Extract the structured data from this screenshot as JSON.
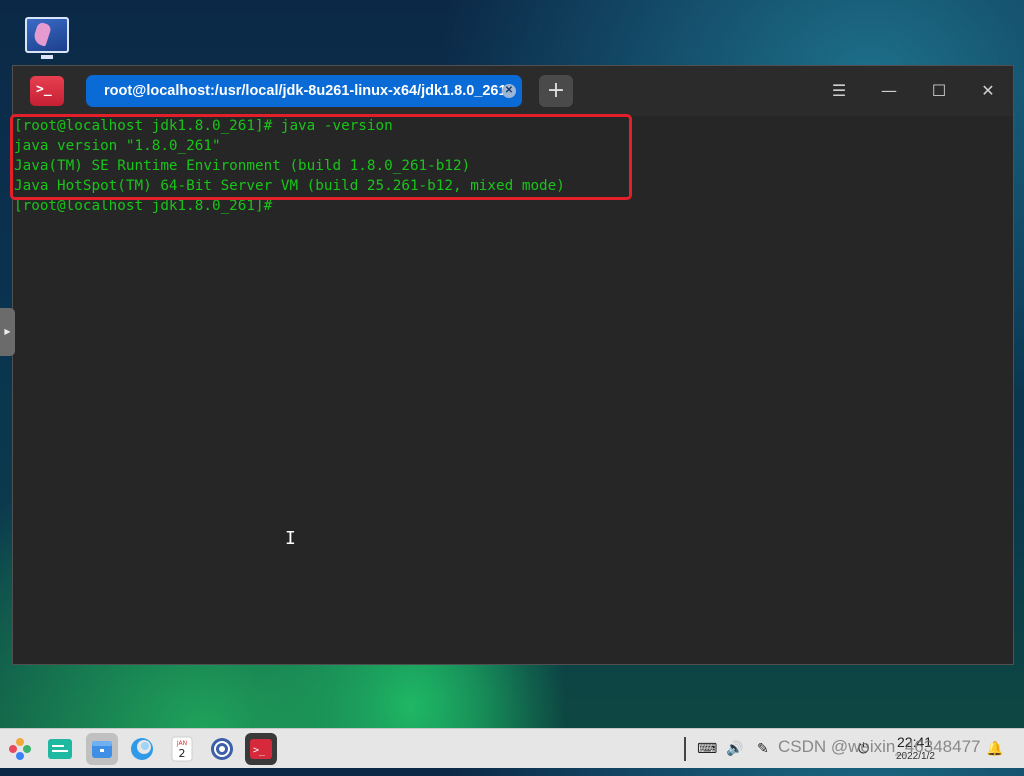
{
  "window": {
    "tab_title": "root@localhost:/usr/local/jdk-8u261-linux-x64/jdk1.8.0_261",
    "app_icon_glyph": ">_",
    "new_tab_glyph": "+",
    "menu_glyph": "☰",
    "minimize_glyph": "—",
    "maximize_glyph": "☐",
    "close_glyph": "✕",
    "tab_close_glyph": "✕"
  },
  "terminal": {
    "lines": [
      "[root@localhost jdk1.8.0_261]# java -version",
      "java version \"1.8.0_261\"",
      "Java(TM) SE Runtime Environment (build 1.8.0_261-b12)",
      "Java HotSpot(TM) 64-Bit Server VM (build 25.261-b12, mixed mode)",
      "[root@localhost jdk1.8.0_261]#"
    ],
    "text_color": "#19c419",
    "highlight_color": "#e3202a"
  },
  "taskbar": {
    "calendar_month": "JAN",
    "calendar_day": "2",
    "clock_time": "22:41",
    "clock_date": "2022/1/2",
    "watermark": "CSDN @weixin_46348477"
  },
  "colors": {
    "tab_active": "#0a6ad6",
    "terminal_bg": "#262626"
  }
}
